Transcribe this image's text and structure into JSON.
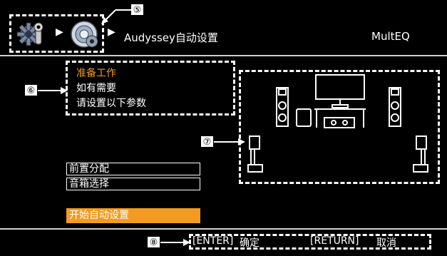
{
  "header": {
    "title": "Audyssey自动设置",
    "mode": "MultEQ",
    "breadcrumb_arrow": "▶"
  },
  "icons": [
    "settings-gears-icon",
    "speaker-gear-icon"
  ],
  "callouts": {
    "c5": "⑤",
    "c6": "⑥",
    "c7": "⑦",
    "c8": "⑧"
  },
  "instructions": {
    "line1": "准备工作",
    "line2": "如有需要",
    "line3": "请设置以下参数"
  },
  "menu": {
    "item1": "前置分配",
    "item2": "音箱选择"
  },
  "start_button": "开始自动设置",
  "footer": {
    "enter_key": "[ENTER]",
    "enter_action": "确定",
    "return_key": "[RETURN]",
    "return_action": "取消"
  },
  "colors": {
    "background": "#000000",
    "text": "#ffffff",
    "accent": "#f39b1f",
    "divider": "#cfcfcf"
  }
}
